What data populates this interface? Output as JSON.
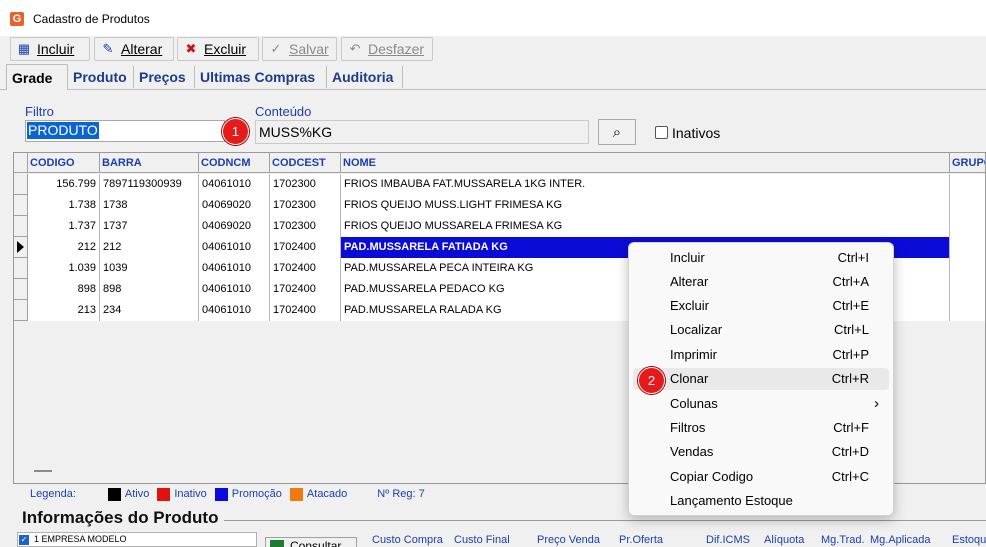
{
  "window": {
    "title": "Cadastro de Produtos",
    "app_icon": "G"
  },
  "toolbar": {
    "incluir": "Incluir",
    "alterar": "Alterar",
    "excluir": "Excluir",
    "salvar": "Salvar",
    "desfazer": "Desfazer"
  },
  "tabs": [
    "Grade",
    "Produto",
    "Preços",
    "Ultimas Compras",
    "Auditoria"
  ],
  "filter": {
    "filtro_label": "Filtro",
    "filtro_value": "PRODUTO",
    "conteudo_label": "Conteúdo",
    "conteudo_value": "MUSS%KG",
    "inativos_label": "Inativos",
    "inativos_checked": false
  },
  "grid": {
    "columns": [
      "CODIGO",
      "BARRA",
      "CODNCM",
      "CODCEST",
      "NOME",
      "GRUPO"
    ],
    "rows": [
      [
        "156.799",
        "7897119300939",
        "04061010",
        "1702300",
        "FRIOS IMBAUBA FAT.MUSSARELA 1KG INTER."
      ],
      [
        "1.738",
        "1738",
        "04069020",
        "1702300",
        "FRIOS QUEIJO MUSS.LIGHT FRIMESA KG"
      ],
      [
        "1.737",
        "1737",
        "04069020",
        "1702300",
        "FRIOS QUEIJO MUSSARELA FRIMESA KG"
      ],
      [
        "212",
        "212",
        "04061010",
        "1702400",
        "PAD.MUSSARELA FATIADA  KG"
      ],
      [
        "1.039",
        "1039",
        "04061010",
        "1702400",
        "PAD.MUSSARELA PECA INTEIRA KG"
      ],
      [
        "898",
        "898",
        "04061010",
        "1702400",
        "PAD.MUSSARELA PEDACO KG"
      ],
      [
        "213",
        "234",
        "04061010",
        "1702400",
        "PAD.MUSSARELA RALADA KG"
      ]
    ],
    "selected_row": 3
  },
  "legend": {
    "label": "Legenda:",
    "items": [
      {
        "label": "Ativo",
        "color": "#000000"
      },
      {
        "label": "Inativo",
        "color": "#e31010"
      },
      {
        "label": "Promoção",
        "color": "#0a0ae0"
      },
      {
        "label": "Atacado",
        "color": "#f07a10"
      }
    ],
    "nreg": "Nº Reg: 7"
  },
  "info": {
    "title": "Informações do Produto",
    "empresa": "1 EMPRESA MODELO",
    "consultar": "Consultar",
    "headers": [
      "Custo Compra",
      "Custo Final",
      "Preço Venda",
      "Pr.Oferta",
      "Dif.ICMS",
      "Alíquota",
      "Mg.Trad.",
      "Mg.Aplicada",
      "Estoqu"
    ]
  },
  "context_menu": [
    {
      "label": "Incluir",
      "shortcut": "Ctrl+I"
    },
    {
      "label": "Alterar",
      "shortcut": "Ctrl+A"
    },
    {
      "label": "Excluir",
      "shortcut": "Ctrl+E"
    },
    {
      "label": "Localizar",
      "shortcut": "Ctrl+L"
    },
    {
      "label": "Imprimir",
      "shortcut": "Ctrl+P"
    },
    {
      "label": "Clonar",
      "shortcut": "Ctrl+R"
    },
    {
      "label": "Colunas",
      "shortcut": "›"
    },
    {
      "label": "Filtros",
      "shortcut": "Ctrl+F"
    },
    {
      "label": "Vendas",
      "shortcut": "Ctrl+D"
    },
    {
      "label": "Copiar Codigo",
      "shortcut": "Ctrl+C"
    },
    {
      "label": "Lançamento Estoque",
      "shortcut": ""
    }
  ],
  "badges": [
    "1",
    "2"
  ]
}
